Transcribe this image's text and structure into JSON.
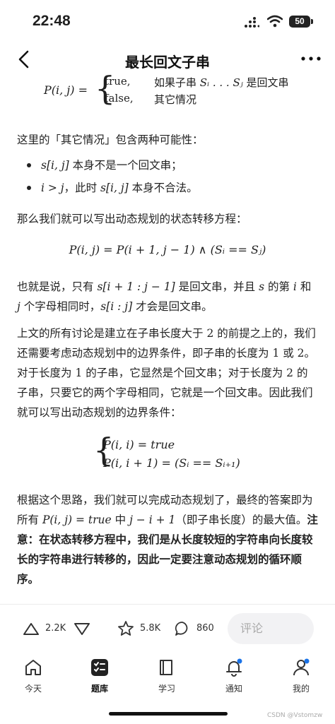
{
  "status": {
    "time": "22:48",
    "battery": "50"
  },
  "nav": {
    "title": "最长回文子串"
  },
  "content": {
    "piecewise": {
      "lhs": "P(i, j) =",
      "case1_val": "true,",
      "case1_cond_pre": "如果子串 ",
      "case1_cond_math": "Sᵢ . . . Sⱼ",
      "case1_cond_post": " 是回文串",
      "case2_val": "false,",
      "case2_cond": "其它情况"
    },
    "p1": "这里的「其它情况」包含两种可能性：",
    "bullet1_math": "s[i, j]",
    "bullet1_text": " 本身不是一个回文串；",
    "bullet2_math": "i > j",
    "bullet2_text_a": "，此时 ",
    "bullet2_math2": "s[i, j]",
    "bullet2_text_b": " 本身不合法。",
    "p2": "那么我们就可以写出动态规划的状态转移方程：",
    "eq1": "P(i, j) = P(i + 1, j − 1) ∧ (Sᵢ == Sⱼ)",
    "p3_a": "也就是说，只有 ",
    "p3_m1": "s[i + 1 : j − 1]",
    "p3_b": " 是回文串，并且 ",
    "p3_m2": "s",
    "p3_c": " 的第 ",
    "p3_m3": "i",
    "p3_d": " 和",
    "p3_m4": "j",
    "p3_e": " 个字母相同时，",
    "p3_m5": "s[i : j]",
    "p3_f": " 才会是回文串。",
    "p4_a": "上文的所有讨论是建立在子串长度大于 ",
    "p4_m1": "2",
    "p4_b": " 的前提之上的，我们还需要考虑动态规划中的边界条件，即子串的长度为 ",
    "p4_m2": "1",
    "p4_c": " 或 ",
    "p4_m3": "2",
    "p4_d": "。对于长度为 ",
    "p4_m4": "1",
    "p4_e": " 的子串，它显然是个回文串；对于长度为 ",
    "p4_m5": "2",
    "p4_f": " 的子串，只要它的两个字母相同，它就是一个回文串。因此我们就可以写出动态规划的边界条件：",
    "eq2_line1": "P(i, i) = true",
    "eq2_line2": "P(i, i + 1) = (Sᵢ == Sᵢ₊₁)",
    "p5_a": "根据这个思路，我们就可以完成动态规划了，最终的答案即为所有 ",
    "p5_m1": "P(i, j) = true",
    "p5_b": " 中 ",
    "p5_m2": "j − i + 1",
    "p5_c": "（即子串长度）的最大值。",
    "p5_bold": "注意：在状态转移方程中，我们是从长度较短的字符串向长度较长的字符串进行转移的，因此一定要注意动态规划的循环顺序。"
  },
  "actions": {
    "upvotes": "2.2K",
    "favorites": "5.8K",
    "comments": "860",
    "comment_placeholder": "评论"
  },
  "tabs": [
    {
      "label": "今天",
      "icon": "home-icon"
    },
    {
      "label": "题库",
      "icon": "problems-icon"
    },
    {
      "label": "学习",
      "icon": "book-icon"
    },
    {
      "label": "通知",
      "icon": "bell-icon"
    },
    {
      "label": "我的",
      "icon": "profile-icon"
    }
  ],
  "watermark": "CSDN @Vstomzw"
}
